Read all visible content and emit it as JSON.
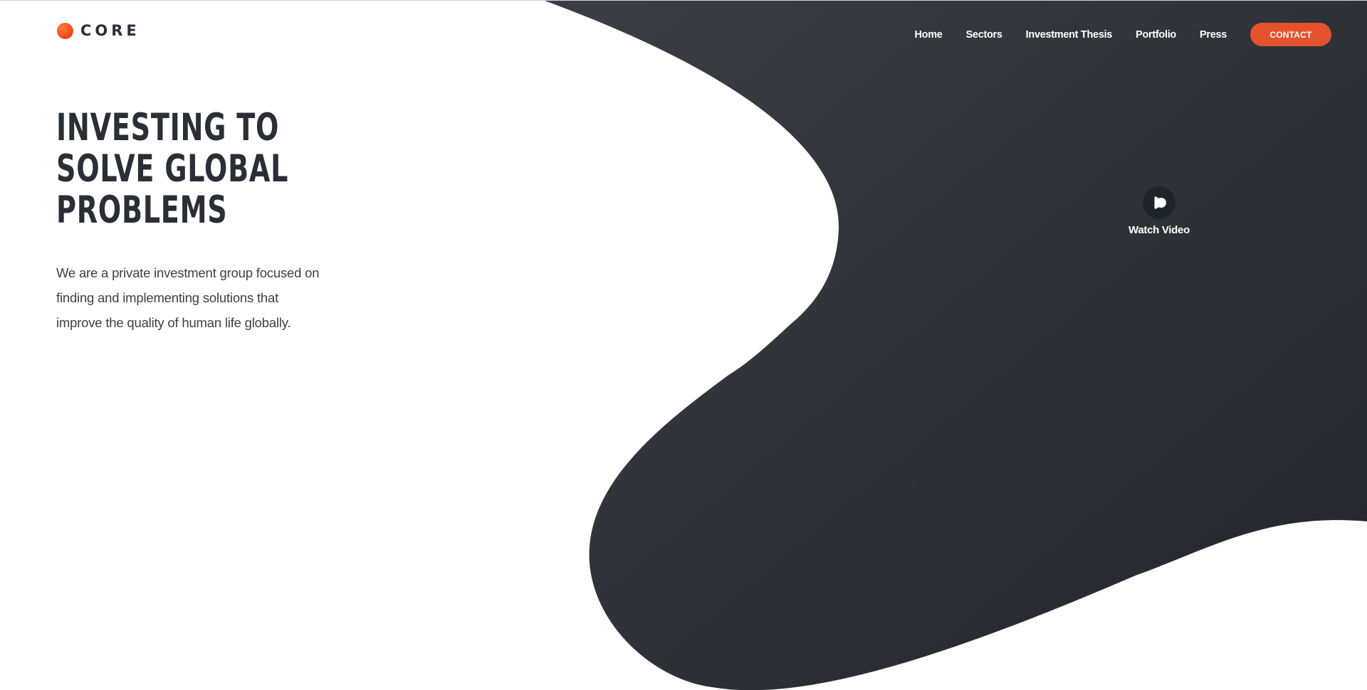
{
  "brand": {
    "name": "CORE",
    "accent_color": "#e4532d",
    "dark_color": "#2a2f36"
  },
  "nav": {
    "items": [
      {
        "label": "Home"
      },
      {
        "label": "Sectors"
      },
      {
        "label": "Investment Thesis"
      },
      {
        "label": "Portfolio"
      },
      {
        "label": "Press"
      }
    ],
    "contact_label": "CONTACT"
  },
  "hero": {
    "title_lines": [
      "INVESTING TO",
      "SOLVE GLOBAL",
      "PROBLEMS"
    ],
    "description_lines": [
      "We are a private investment group focused on",
      "finding and implementing solutions that",
      "improve the quality of human life globally."
    ]
  },
  "video": {
    "label": "Watch Video",
    "icon": "play-icon"
  }
}
